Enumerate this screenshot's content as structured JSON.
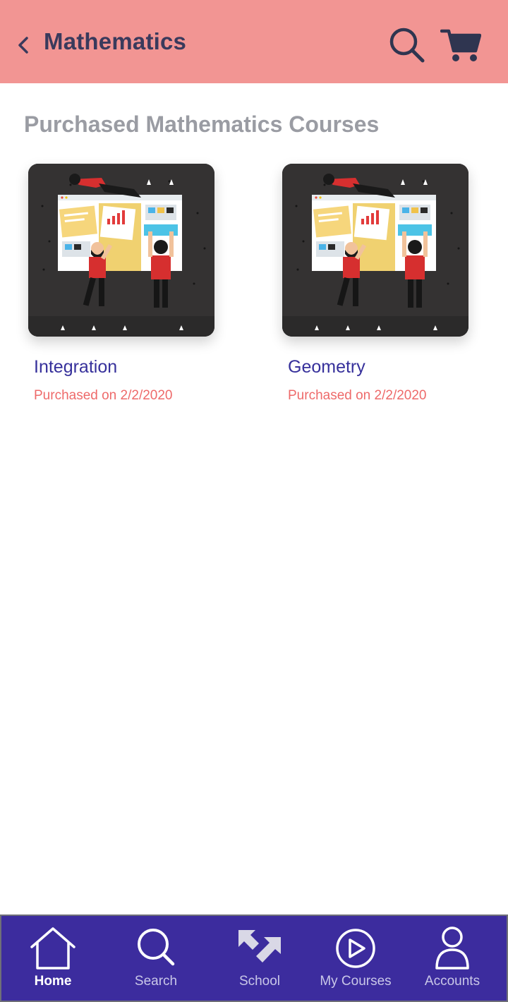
{
  "header": {
    "title": "Mathematics",
    "back_icon": "chevron-left-icon",
    "search_icon": "search-icon",
    "cart_icon": "cart-icon",
    "background_color": "#f29593"
  },
  "main": {
    "section_title": "Purchased Mathematics Courses",
    "courses": [
      {
        "title": "Integration",
        "purchased": "Purchased on 2/2/2020",
        "thumbnail": "team-building-dashboard-illustration"
      },
      {
        "title": "Geometry",
        "purchased": "Purchased on 2/2/2020",
        "thumbnail": "team-building-dashboard-illustration"
      }
    ]
  },
  "bottom_nav": {
    "background_color": "#3c2c9e",
    "items": [
      {
        "label": "Home",
        "icon": "home-icon",
        "active": true
      },
      {
        "label": "Search",
        "icon": "search-icon",
        "active": false
      },
      {
        "label": "School",
        "icon": "school-arrows-icon",
        "active": false
      },
      {
        "label": "My Courses",
        "icon": "play-circle-icon",
        "active": false
      },
      {
        "label": "Accounts",
        "icon": "user-icon",
        "active": false
      }
    ]
  }
}
